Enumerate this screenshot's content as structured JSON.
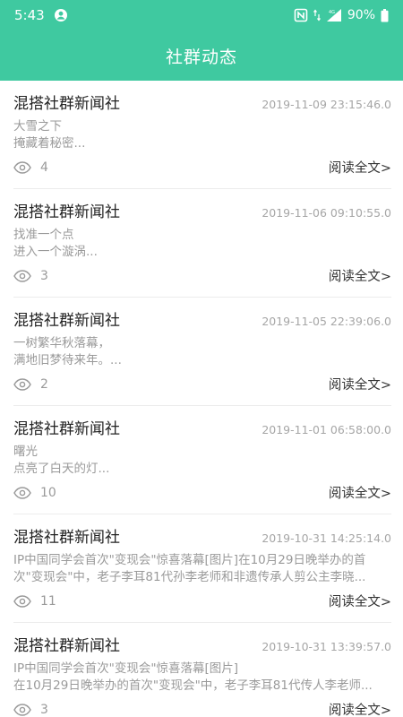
{
  "status_bar": {
    "time": "5:43",
    "battery": "90%",
    "network": "4G"
  },
  "header": {
    "title": "社群动态"
  },
  "read_more_label": "阅读全文>",
  "posts": [
    {
      "source": "混搭社群新闻社",
      "time": "2019-11-09 23:15:46.0",
      "line1": "大雪之下",
      "line2": "掩藏着秘密...",
      "views": "4"
    },
    {
      "source": "混搭社群新闻社",
      "time": "2019-11-06 09:10:55.0",
      "line1": "找准一个点",
      "line2": "进入一个漩涡...",
      "views": "3"
    },
    {
      "source": "混搭社群新闻社",
      "time": "2019-11-05 22:39:06.0",
      "line1": "一树繁华秋落幕，",
      "line2": "满地旧梦待来年。...",
      "views": "2"
    },
    {
      "source": "混搭社群新闻社",
      "time": "2019-11-01 06:58:00.0",
      "line1": "曙光",
      "line2": "点亮了白天的灯...",
      "views": "10"
    },
    {
      "source": "混搭社群新闻社",
      "time": "2019-10-31 14:25:14.0",
      "line1": "IP中国同学会首次\"变现会\"惊喜落幕[图片]在10月29日晚举办的首",
      "line2": "次\"变现会\"中，老子李耳81代孙李老师和非遗传承人剪公主李晓...",
      "views": "11"
    },
    {
      "source": "混搭社群新闻社",
      "time": "2019-10-31 13:39:57.0",
      "line1": "IP中国同学会首次\"变现会\"惊喜落幕[图片]",
      "line2": "在10月29日晚举办的首次\"变现会\"中，老子李耳81代传人李老师...",
      "views": "3"
    }
  ]
}
